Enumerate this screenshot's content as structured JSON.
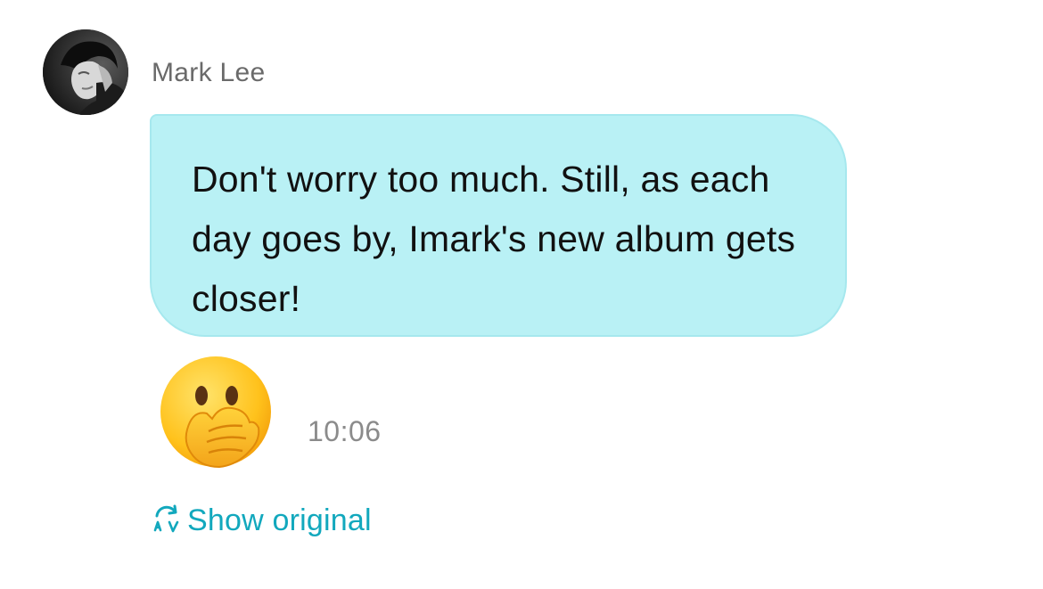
{
  "message": {
    "sender_name": "Mark Lee",
    "text": "Don't worry too much. Still, as each day goes by, Imark's new album gets closer!",
    "reaction_emoji": "face-with-hand-over-mouth-icon",
    "timestamp": "10:06",
    "show_original_label": "Show original",
    "translate_icon": "translate-refresh-icon"
  },
  "colors": {
    "bubble_background": "#b9f1f5",
    "accent": "#12a8bd",
    "sender_name": "#6a6a6a",
    "timestamp": "#8b8b8b",
    "message_text": "#111111"
  }
}
